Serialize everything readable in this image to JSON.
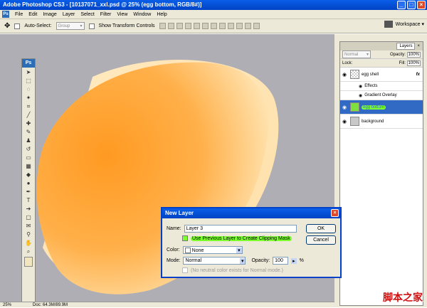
{
  "window": {
    "title": "Adobe Photoshop CS3 - [10137071_xxl.psd @ 25% (egg bottom, RGB/8#)]",
    "btn_min": "_",
    "btn_max": "□",
    "btn_close": "×"
  },
  "menu": [
    "File",
    "Edit",
    "Image",
    "Layer",
    "Select",
    "Filter",
    "View",
    "Window",
    "Help"
  ],
  "menu_icon": "Ps",
  "options": {
    "auto_select_label": "Auto-Select:",
    "auto_select_value": "Group",
    "transform_label": "Show Transform Controls",
    "workspace_label": "Workspace ▾"
  },
  "toolbox": {
    "logo": "Ps"
  },
  "layers": {
    "tabs": [
      "Layers",
      "×"
    ],
    "blend_mode": "Normal",
    "opacity_label": "Opacity:",
    "opacity_value": "100%",
    "lock_label": "Lock:",
    "fill_label": "Fill:",
    "fill_value": "100%",
    "items": [
      {
        "name": "egg shell",
        "fx": "fx"
      },
      {
        "name": "Effects"
      },
      {
        "name": "Gradient Overlay"
      },
      {
        "name": "egg bottom"
      },
      {
        "name": "background"
      }
    ]
  },
  "dialog": {
    "title": "New Layer",
    "name_label": "Name:",
    "name_value": "Layer 3",
    "clip_label": "Use Previous Layer to Create Clipping Mask",
    "color_label": "Color:",
    "color_value": "None",
    "mode_label": "Mode:",
    "mode_value": "Normal",
    "opacity_label": "Opacity:",
    "opacity_value": "100",
    "opacity_unit": "%",
    "neutral_label": "(No neutral color exists for Normal mode.)",
    "ok": "OK",
    "cancel": "Cancel"
  },
  "status": {
    "zoom": "25%",
    "doc": "Doc: 64.3M/89.9M"
  },
  "watermark": "脚本之家"
}
